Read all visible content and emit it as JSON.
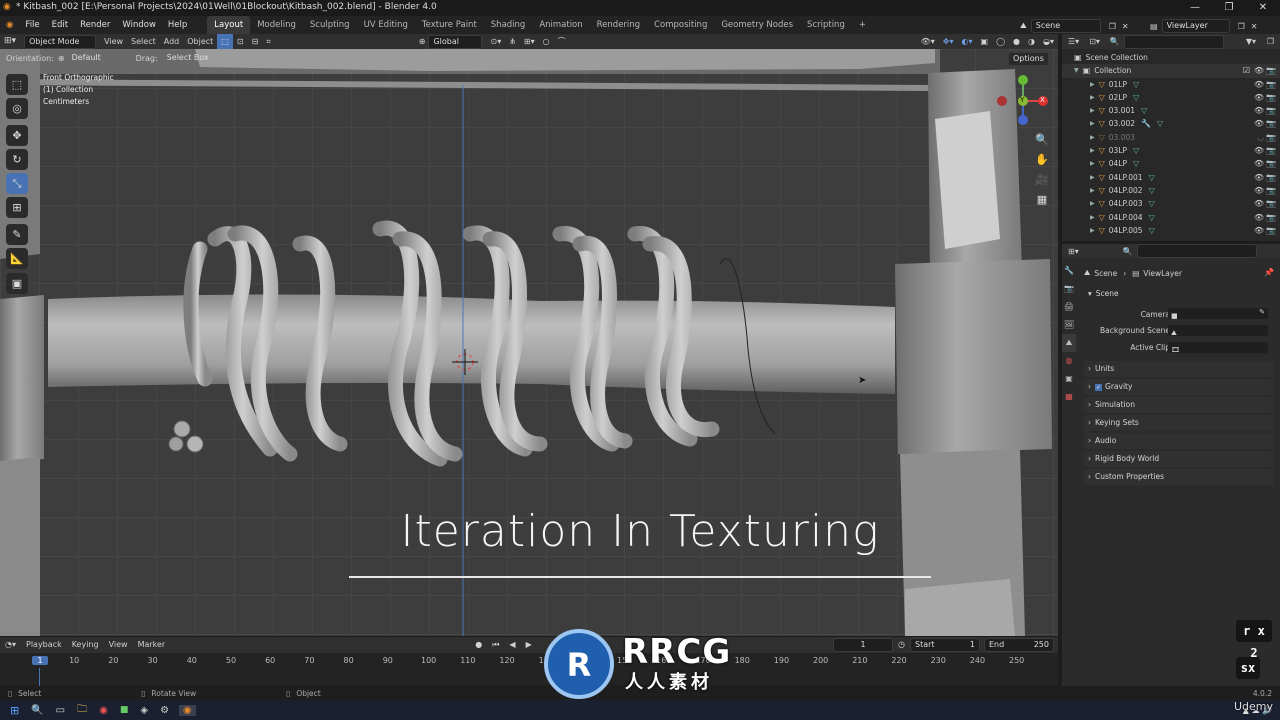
{
  "window": {
    "title": "* Kitbash_002 [E:\\Personal Projects\\2024\\01Well\\01Blockout\\Kitbash_002.blend] - Blender 4.0",
    "controls": [
      "—",
      "❐",
      "✕"
    ]
  },
  "menu": [
    "File",
    "Edit",
    "Render",
    "Window",
    "Help"
  ],
  "workspaces": [
    "Layout",
    "Modeling",
    "Sculpting",
    "UV Editing",
    "Texture Paint",
    "Shading",
    "Animation",
    "Rendering",
    "Compositing",
    "Geometry Nodes",
    "Scripting",
    "+"
  ],
  "active_workspace": "Layout",
  "scene_selector": "Scene",
  "viewlayer_selector": "ViewLayer",
  "viewport_header": {
    "mode": "Object Mode",
    "menus": [
      "View",
      "Select",
      "Add",
      "Object"
    ],
    "transform": "Global"
  },
  "tool_settings": {
    "orientation_label": "Orientation:",
    "orientation": "Default",
    "drag_label": "Drag:",
    "drag": "Select Box",
    "options": "Options"
  },
  "viewport_info": {
    "view": "Front Orthographic",
    "collection": "(1) Collection",
    "units": "Centimeters"
  },
  "tools": [
    "select-box",
    "cursor",
    "move",
    "rotate",
    "scale",
    "transform",
    "annotate",
    "measure",
    "add-cube"
  ],
  "gizmo": {
    "x": "X",
    "y": "Y",
    "z": "Z"
  },
  "outliner": {
    "root": "Scene Collection",
    "collection": "Collection",
    "items": [
      "01LP",
      "02LP",
      "03.001",
      "03.002",
      "03.003",
      "03LP",
      "04LP",
      "04LP.001",
      "04LP.002",
      "04LP.003",
      "04LP.004",
      "04LP.005"
    ]
  },
  "properties": {
    "breadcrumb_scene": "Scene",
    "breadcrumb_viewlayer": "ViewLayer",
    "section": "Scene",
    "camera_label": "Camera",
    "background_label": "Background Scene",
    "clip_label": "Active Clip",
    "panels": [
      "Units",
      "Gravity",
      "Simulation",
      "Keying Sets",
      "Audio",
      "Rigid Body World",
      "Custom Properties"
    ]
  },
  "timeline": {
    "menus": [
      "Playback",
      "Keying",
      "View",
      "Marker"
    ],
    "current_frame": "1",
    "start_label": "Start",
    "start": "1",
    "end_label": "End",
    "end": "250",
    "ticks": [
      "1",
      "10",
      "20",
      "30",
      "40",
      "50",
      "60",
      "70",
      "80",
      "90",
      "100",
      "110",
      "120",
      "130",
      "140",
      "150",
      "160",
      "170",
      "180",
      "190",
      "200",
      "210",
      "220",
      "230",
      "240",
      "250"
    ]
  },
  "statusbar": {
    "select": "Select",
    "rotate": "Rotate View",
    "object": "Object",
    "version": "4.0.2"
  },
  "overlay": {
    "title": "Iteration In Texturing",
    "speed": "r x 2",
    "sx": "sx",
    "watermark_main": "RRCG",
    "watermark_sub": "人人素材",
    "watermark_udemy": "Udemy"
  }
}
